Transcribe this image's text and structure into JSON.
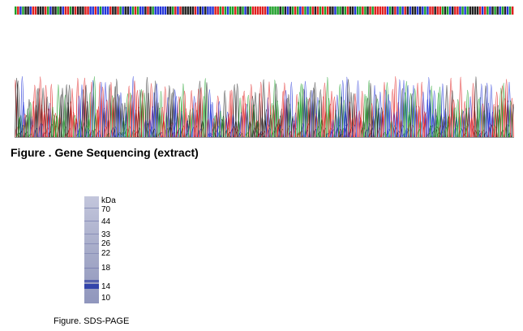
{
  "sequencing": {
    "caption": "Figure . Gene Sequencing (extract)",
    "base_colors": {
      "A": "#1fa02a",
      "C": "#2436d8",
      "G": "#222222",
      "T": "#e02020"
    }
  },
  "gel": {
    "unit_label": "kDa",
    "markers": [
      "70",
      "44",
      "33",
      "26",
      "22",
      "18",
      "14",
      "10"
    ],
    "caption": "Figure. SDS-PAGE",
    "lane_color": "#9ea3c8",
    "band_color": "#3344aa"
  }
}
